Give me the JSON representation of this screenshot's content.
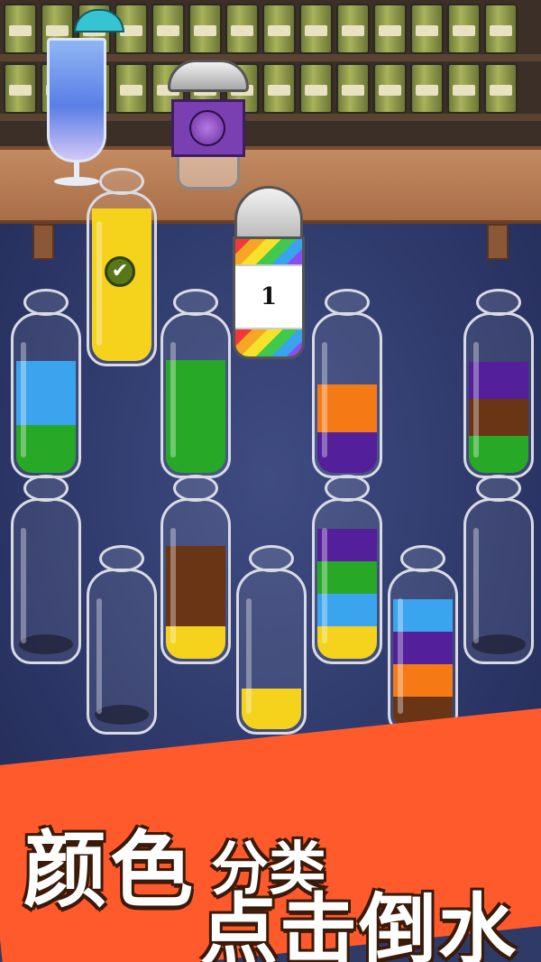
{
  "level": {
    "number": "1"
  },
  "colors": {
    "yellow": "#f5d21c",
    "blue": "#3aa4ef",
    "green": "#27a826",
    "orange": "#f57a16",
    "purple": "#541f9a",
    "brown": "#6a3515",
    "banner": "#ff5a2c"
  },
  "bottles": [
    {
      "id": "bottle-1",
      "layers": [
        "green",
        "blue"
      ],
      "fills": [
        0.3,
        0.4
      ]
    },
    {
      "id": "bottle-2",
      "layers": [
        "yellow"
      ],
      "fills": [
        0.9
      ],
      "completed": true
    },
    {
      "id": "bottle-3",
      "layers": [
        "green"
      ],
      "fills": [
        0.7
      ]
    },
    {
      "id": "bottle-4",
      "layers": [
        "purple",
        "orange"
      ],
      "fills": [
        0.25,
        0.3
      ]
    },
    {
      "id": "bottle-5",
      "layers": [
        "green",
        "brown",
        "purple"
      ],
      "fills": [
        0.23,
        0.23,
        0.23
      ]
    },
    {
      "id": "bottle-6",
      "layers": [],
      "fills": []
    },
    {
      "id": "bottle-7",
      "layers": [],
      "fills": []
    },
    {
      "id": "bottle-8",
      "layers": [
        "yellow",
        "brown"
      ],
      "fills": [
        0.2,
        0.5
      ]
    },
    {
      "id": "bottle-9",
      "layers": [
        "yellow"
      ],
      "fills": [
        0.25
      ]
    },
    {
      "id": "bottle-10",
      "layers": [
        "yellow",
        "blue",
        "green",
        "purple"
      ],
      "fills": [
        0.2,
        0.2,
        0.2,
        0.2
      ]
    },
    {
      "id": "bottle-11",
      "layers": [
        "brown",
        "orange",
        "purple",
        "blue"
      ],
      "fills": [
        0.2,
        0.2,
        0.2,
        0.2
      ]
    },
    {
      "id": "bottle-12",
      "layers": [],
      "fills": []
    }
  ],
  "slogan": {
    "line1_big": "颜色",
    "line1_small": "分类",
    "line2": "点击倒水"
  }
}
